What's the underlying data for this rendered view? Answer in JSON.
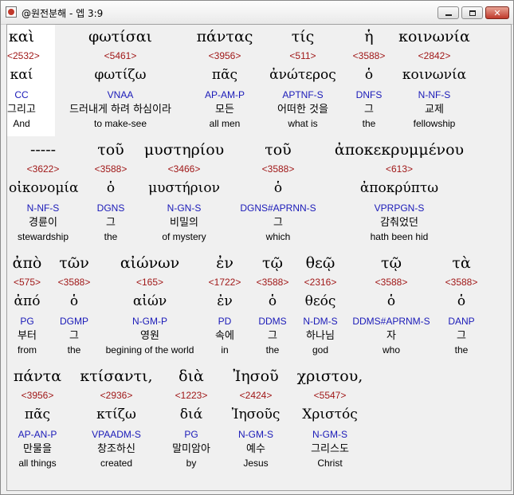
{
  "window": {
    "title": "@원전분해 - 엡 3:9"
  },
  "colors": {
    "strong": "#a01818",
    "morph": "#1a1ab8",
    "text": "#000000",
    "highlight": "#ffffff"
  },
  "rows": [
    {
      "words": [
        {
          "greek": "καὶ",
          "strong": "<2532>",
          "lemma": "καί",
          "morph": "CC",
          "korean": "그리고",
          "english": "And"
        },
        {
          "greek": "φωτίσαι",
          "strong": "<5461>",
          "lemma": "φωτίζω",
          "morph": "VNAA",
          "korean": "드러내게 하려 하심이라",
          "english": "to make-see"
        },
        {
          "greek": "πάντας",
          "strong": "<3956>",
          "lemma": "πᾶς",
          "morph": "AP-AM-P",
          "korean": "모든",
          "english": "all men"
        },
        {
          "greek": "τίς",
          "strong": "<511>",
          "lemma": "ἀνώτερος",
          "morph": "APTNF-S",
          "korean": "어떠한 것을",
          "english": "what is"
        },
        {
          "greek": "ἡ",
          "strong": "<3588>",
          "lemma": "ὁ",
          "morph": "DNFS",
          "korean": "그",
          "english": "the"
        },
        {
          "greek": "κοινωνία",
          "strong": "<2842>",
          "lemma": "κοινωνία",
          "morph": "N-NF-S",
          "korean": "교제",
          "english": "fellowship"
        }
      ]
    },
    {
      "words": [
        {
          "greek": "-----",
          "strong": "<3622>",
          "lemma": "οἰκονομία",
          "morph": "N-NF-S",
          "korean": "경륜이",
          "english": "stewardship"
        },
        {
          "greek": "τοῦ",
          "strong": "<3588>",
          "lemma": "ὁ",
          "morph": "DGNS",
          "korean": "그",
          "english": "the"
        },
        {
          "greek": "μυστηρίου",
          "strong": "<3466>",
          "lemma": "μυστήριον",
          "morph": "N-GN-S",
          "korean": "비밀의",
          "english": "of mystery"
        },
        {
          "greek": "τοῦ",
          "strong": "<3588>",
          "lemma": "ὁ",
          "morph": "DGNS#APRNN-S",
          "korean": "그",
          "english": "which"
        },
        {
          "greek": "ἀποκεκρυμμένου",
          "strong": "<613>",
          "lemma": "ἀποκρύπτω",
          "morph": "VPRPGN-S",
          "korean": "감춰었던",
          "english": "hath been hid"
        }
      ]
    },
    {
      "words": [
        {
          "greek": "ἀπὸ",
          "strong": "<575>",
          "lemma": "ἀπό",
          "morph": "PG",
          "korean": "부터",
          "english": "from"
        },
        {
          "greek": "τῶν",
          "strong": "<3588>",
          "lemma": "ὁ",
          "morph": "DGMP",
          "korean": "그",
          "english": "the"
        },
        {
          "greek": "αἰώνων",
          "strong": "<165>",
          "lemma": "αἰών",
          "morph": "N-GM-P",
          "korean": "영원",
          "english": "begining of the world"
        },
        {
          "greek": "ἐν",
          "strong": "<1722>",
          "lemma": "ἐν",
          "morph": "PD",
          "korean": "속에",
          "english": "in"
        },
        {
          "greek": "τῷ",
          "strong": "<3588>",
          "lemma": "ὁ",
          "morph": "DDMS",
          "korean": "그",
          "english": "the"
        },
        {
          "greek": "θεῷ",
          "strong": "<2316>",
          "lemma": "θεός",
          "morph": "N-DM-S",
          "korean": "하나님",
          "english": "god"
        },
        {
          "greek": "τῷ",
          "strong": "<3588>",
          "lemma": "ὁ",
          "morph": "DDMS#APRNM-S",
          "korean": "자",
          "english": "who"
        },
        {
          "greek": "τὰ",
          "strong": "<3588>",
          "lemma": "ὁ",
          "morph": "DANP",
          "korean": "그",
          "english": "the"
        }
      ]
    },
    {
      "words": [
        {
          "greek": "πάντα",
          "strong": "<3956>",
          "lemma": "πᾶς",
          "morph": "AP-AN-P",
          "korean": "만물을",
          "english": "all things"
        },
        {
          "greek": "κτίσαντι,",
          "strong": "<2936>",
          "lemma": "κτίζω",
          "morph": "VPAADM-S",
          "korean": "창조하신",
          "english": "created"
        },
        {
          "greek": "διὰ",
          "strong": "<1223>",
          "lemma": "διά",
          "morph": "PG",
          "korean": "말미암아",
          "english": "by"
        },
        {
          "greek": "Ἰησοῦ",
          "strong": "<2424>",
          "lemma": "Ἰησοῦς",
          "morph": "N-GM-S",
          "korean": "예수",
          "english": "Jesus"
        },
        {
          "greek": "χριστου,",
          "strong": "<5547>",
          "lemma": "Χριστός",
          "morph": "N-GM-S",
          "korean": "그리스도",
          "english": "Christ"
        }
      ]
    }
  ]
}
